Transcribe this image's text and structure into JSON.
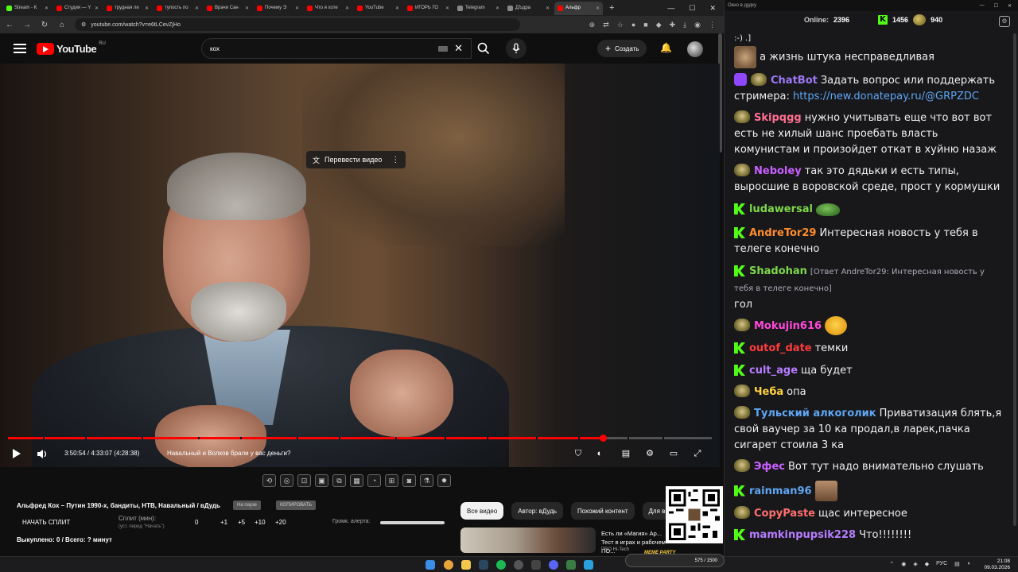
{
  "browser": {
    "tabs": [
      {
        "label": "Stream - K",
        "color": "#53fc18"
      },
      {
        "label": "Студия — Y",
        "color": "#ff0000"
      },
      {
        "label": "трудная ли",
        "color": "#ff0000"
      },
      {
        "label": "тупость по",
        "color": "#ff0000"
      },
      {
        "label": "Врачи Сан",
        "color": "#ff0000"
      },
      {
        "label": "Почему Э",
        "color": "#ff0000"
      },
      {
        "label": "Что я хоте",
        "color": "#ff0000"
      },
      {
        "label": "YouTube",
        "color": "#ff0000"
      },
      {
        "label": "ИГОРЬ ГО",
        "color": "#ff0000"
      },
      {
        "label": "Telegram",
        "color": "#888888"
      },
      {
        "label": "ДЪдра",
        "color": "#888888"
      },
      {
        "label": "Альфр",
        "color": "#ff0000",
        "active": true
      }
    ],
    "new_tab": "+",
    "url": "youtube.com/watch?v=e6tLCevZjHo"
  },
  "yt": {
    "logo_text": "YouTube",
    "region": "RU",
    "search_value": "кох",
    "create_label": "Создать"
  },
  "video": {
    "translate_label": "Перевести видео",
    "time": "3:50:54 / 4:33:07 (4:28:38)",
    "chapter": "Навальный и Волков брали у вас деньги?",
    "progress": 0.845,
    "title": "Альфред Кох – Путин 1990-х, бандиты, НТВ, Навальный / вДудь",
    "tag_1": "На паузе",
    "tag_2": "КОПИРОВАТЬ"
  },
  "split": {
    "button": "НАЧАТЬ СПЛИТ",
    "min_label": "Сплит (мин):",
    "min_hint": "(уст. перед \"Начать\")",
    "value": "0",
    "steps": [
      "+1",
      "+5",
      "+10",
      "+20"
    ],
    "alert_label": "Громк. алерта:",
    "redeemed": "Выкуплено: 0 / Всего: ? минут"
  },
  "chips": [
    "Все видео",
    "Автор: вДудь",
    "Похожий контент",
    "Для в"
  ],
  "recommendation": {
    "title": "Есть ли «Магия» Ар... Тест в играх и рабочем ПО...",
    "meta": "PRO Hi-Tech"
  },
  "chat": {
    "window_title": "Окно в дудку",
    "online_label": "Online:",
    "online": "2396",
    "kick_count": "1456",
    "other_count": "940",
    "messages": [
      {
        "user": "",
        "text": ":-) .]",
        "badge": "none"
      },
      {
        "user": "",
        "text": "а жизнь штука несправедливая",
        "badge": "cat"
      },
      {
        "user": "ChatBot",
        "color": "#9e79f7",
        "text": "Задать вопрос или поддержать стримера:",
        "link": "https://new.donatepay.ru/@GRPZDC",
        "badge": "bot"
      },
      {
        "user": "Skipqgg",
        "color": "#ff6f91",
        "text": "нужно учитывать еще что вот вот есть не хилый шанс проебать власть комунистам и произойдет откат в хуйню назаж",
        "badge": "pepe"
      },
      {
        "user": "Neboley",
        "color": "#c960ff",
        "text": "так это дядьки и есть типы, выросшие в воровской среде, прост у кормушки",
        "badge": "pepe"
      },
      {
        "user": "ludawersal",
        "color": "#7dd94a",
        "text": "",
        "badge": "k"
      },
      {
        "user": "AndreTor29",
        "color": "#ff8c2b",
        "text": "Интересная новость у тебя в телеге конечно",
        "badge": "k"
      },
      {
        "user": "Shadohan",
        "color": "#7dd94a",
        "reply": "[Ответ AndreTor29: Интересная новость у тебя в телеге конечно]",
        "text": "гол",
        "badge": "k"
      },
      {
        "user": "Mokujin616",
        "color": "#ff49d8",
        "text": "",
        "badge": "pepe"
      },
      {
        "user": "outof_date",
        "color": "#ff3b3b",
        "text": "темки",
        "badge": "k"
      },
      {
        "user": "cult_age",
        "color": "#b77dff",
        "text": "ща будет",
        "badge": "k"
      },
      {
        "user": "Чеба",
        "color": "#ffd23f",
        "text": "опа",
        "badge": "pepe"
      },
      {
        "user": "Тульский алкоголик",
        "color": "#5fa6f3",
        "text": "Приватизация блять,я свой ваучер за 10 ка продал,в ларек,пачка сигарет стоила 3 ка",
        "badge": "pepe"
      },
      {
        "user": "Эфес",
        "color": "#c960ff",
        "text": "Вот тут надо внимательно слушать",
        "badge": "pepe"
      },
      {
        "user": "rainman96",
        "color": "#5fa6f3",
        "text": "",
        "badge": "k"
      },
      {
        "user": "CopyPaste",
        "color": "#ff6f6f",
        "text": "щас интересное",
        "badge": "pepe"
      },
      {
        "user": "mamkinpupsik228",
        "color": "#b77dff",
        "text": "Что!!!!!!!!",
        "badge": "k"
      }
    ]
  },
  "taskbar": {
    "meme_label": "MEME PARTY",
    "meme_progress": "575 / 1500",
    "lang": "РУС",
    "time": "21:08",
    "date": "09.03.2026"
  }
}
